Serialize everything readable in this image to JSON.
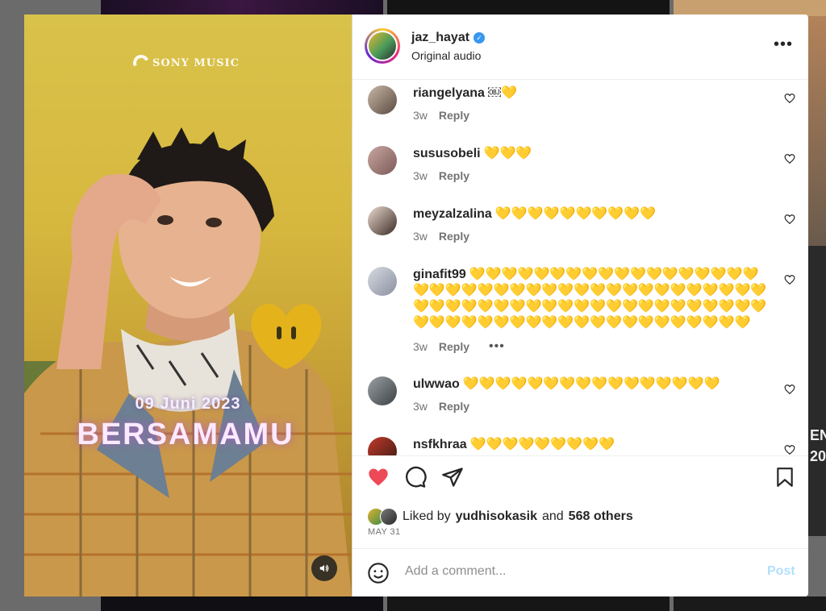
{
  "background": {
    "side_text_1": "EN",
    "side_text_2": "20"
  },
  "media": {
    "brand": "SONY MUSIC",
    "date": "09 Juni 2023",
    "title": "BERSAMAMU",
    "mute_icon": "speaker-icon"
  },
  "post": {
    "username": "jaz_hayat",
    "verified": true,
    "audio": "Original audio",
    "more_icon": "more-options-icon"
  },
  "comments": [
    {
      "user": "riangelyana",
      "text": "￼💛",
      "time": "3w",
      "reply": "Reply"
    },
    {
      "user": "sususobeli",
      "text": "💛💛💛",
      "time": "3w",
      "reply": "Reply"
    },
    {
      "user": "meyzalzalina",
      "text": "💛💛💛💛💛💛💛💛💛💛",
      "time": "3w",
      "reply": "Reply"
    },
    {
      "user": "ginafit99",
      "text": "💛💛💛💛💛💛💛💛💛💛💛💛💛💛💛💛💛💛💛💛💛💛💛💛💛💛💛💛💛💛💛💛💛💛💛💛💛💛💛💛💛💛💛💛💛💛💛💛💛💛💛💛💛💛💛💛💛💛💛💛💛💛💛💛💛💛💛💛💛💛💛💛💛💛💛💛💛💛💛💛💛💛💛",
      "time": "3w",
      "reply": "Reply",
      "more": "•••"
    },
    {
      "user": "ulwwao",
      "text": "💛💛💛💛💛💛💛💛💛💛💛💛💛💛💛💛",
      "time": "3w",
      "reply": "Reply"
    },
    {
      "user": "nsfkhraa",
      "text": "💛💛💛💛💛💛💛💛💛",
      "time": "",
      "reply": ""
    }
  ],
  "actions": {
    "liked": true,
    "liked_by_prefix": "Liked by",
    "liked_by_user": "yudhisokasik",
    "and": "and",
    "others": "568 others",
    "date": "MAY 31"
  },
  "comment_bar": {
    "placeholder": "Add a comment...",
    "post_label": "Post"
  },
  "colors": {
    "like_red": "#ed4956",
    "verified_blue": "#3897f0",
    "post_disabled": "#b2dffc"
  }
}
